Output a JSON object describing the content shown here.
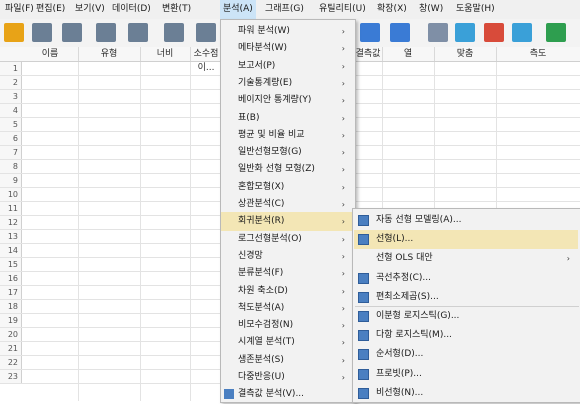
{
  "menubar": [
    "파일(F)",
    "편집(E)",
    "보기(V)",
    "데이터(D)",
    "변환(T)",
    "분석(A)",
    "그래프(G)",
    "유틸리티(U)",
    "확장(X)",
    "창(W)",
    "도움말(H)"
  ],
  "columns": [
    "이름",
    "유형",
    "너비",
    "소수점이...",
    "결측값",
    "열",
    "맞춤",
    "측도"
  ],
  "rows": [
    "1",
    "2",
    "3",
    "4",
    "5",
    "6",
    "7",
    "8",
    "9",
    "10",
    "11",
    "12",
    "13",
    "14",
    "15",
    "16",
    "17",
    "18",
    "19",
    "20",
    "21",
    "22",
    "23"
  ],
  "analyze_menu": [
    {
      "label": "파워 분석(W)",
      "sub": true
    },
    {
      "label": "메타분석(W)",
      "sub": true
    },
    {
      "label": "보고서(P)",
      "sub": true
    },
    {
      "label": "기술통계량(E)",
      "sub": true
    },
    {
      "label": "베이지안 통계량(Y)",
      "sub": true
    },
    {
      "label": "표(B)",
      "sub": true
    },
    {
      "label": "평균 및 비율 비교",
      "sub": true
    },
    {
      "label": "일반선형모형(G)",
      "sub": true
    },
    {
      "label": "일반화 선형 모형(Z)",
      "sub": true
    },
    {
      "label": "혼합모형(X)",
      "sub": true
    },
    {
      "label": "상관분석(C)",
      "sub": true
    },
    {
      "label": "회귀분석(R)",
      "sub": true,
      "highlight": true
    },
    {
      "label": "로그선형분석(O)",
      "sub": true
    },
    {
      "label": "신경망",
      "sub": true
    },
    {
      "label": "분류분석(F)",
      "sub": true
    },
    {
      "label": "차원 축소(D)",
      "sub": true
    },
    {
      "label": "척도분석(A)",
      "sub": true
    },
    {
      "label": "비모수검정(N)",
      "sub": true
    },
    {
      "label": "시계열 분석(T)",
      "sub": true
    },
    {
      "label": "생존분석(S)",
      "sub": true
    },
    {
      "label": "다중반응(U)",
      "sub": true
    },
    {
      "label": "결측값 분석(V)...",
      "sub": false
    }
  ],
  "regression_menu": [
    {
      "label": "자동 선형 모델링(A)...",
      "icon": true
    },
    {
      "label": "선형(L)...",
      "icon": true,
      "highlight": true
    },
    {
      "label": "선형 OLS 대안",
      "icon": false,
      "sub": true
    },
    {
      "label": "곡선추정(C)...",
      "icon": true
    },
    {
      "label": "편최소제곱(S)...",
      "icon": true
    },
    {
      "label": "이분형 로지스틱(G)...",
      "icon": true
    },
    {
      "label": "다항 로지스틱(M)...",
      "icon": true
    },
    {
      "label": "순서형(D)...",
      "icon": true
    },
    {
      "label": "프로빗(P)...",
      "icon": true
    },
    {
      "label": "비선형(N)...",
      "icon": true
    }
  ],
  "icons": {
    "toolbar": [
      "open-folder-icon",
      "save-icon",
      "print-icon",
      "dialog-recall-icon",
      "undo-icon",
      "redo-icon",
      "goto-icon",
      "data-view-icon",
      "variable-view-icon",
      "split-file-icon",
      "weight-cases-icon",
      "select-cases-icon",
      "value-labels-icon",
      "use-sets-icon"
    ],
    "submenu_arrow": "chevron-right-icon"
  },
  "colors": {
    "menu_highlight": "#f3e6b5",
    "menubar_active": "#cce4f7",
    "icon_blue": "#4a7fc1"
  }
}
